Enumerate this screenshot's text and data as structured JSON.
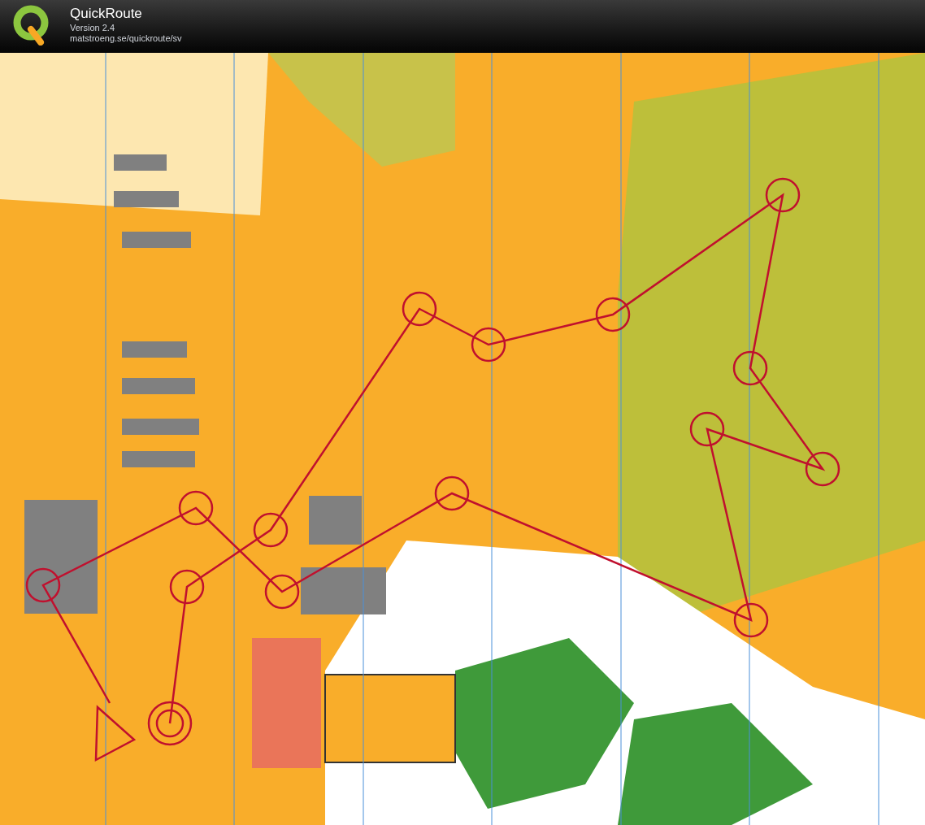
{
  "app": {
    "title": "QuickRoute",
    "version": "Version 2.4",
    "url": "matstroeng.se/quickroute/sv"
  }
}
